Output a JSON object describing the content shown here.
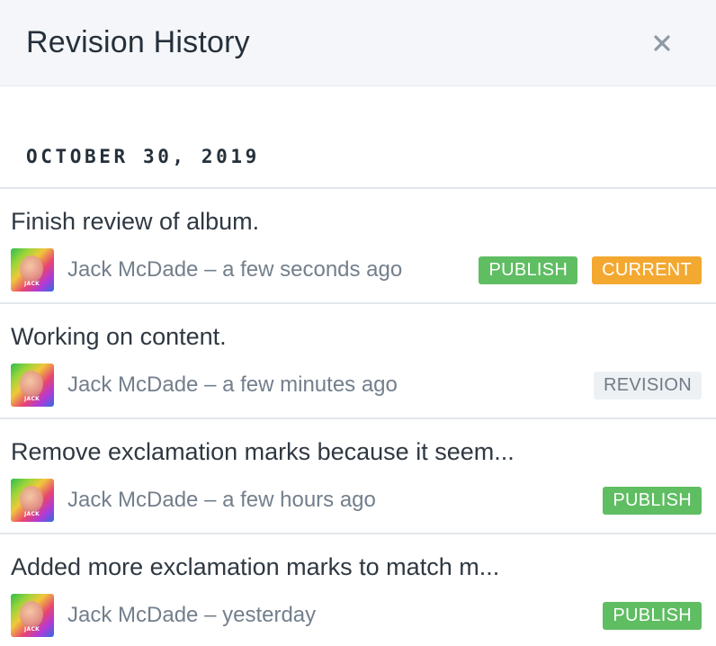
{
  "header": {
    "title": "Revision History",
    "close_icon": "close-icon"
  },
  "date_group": {
    "label": "OCTOBER 30, 2019"
  },
  "revisions": [
    {
      "message": "Finish review of album.",
      "author": "Jack McDade",
      "separator": "–",
      "time": "a few seconds ago",
      "avatar_label": "JACK",
      "badges": [
        {
          "label": "PUBLISH",
          "kind": "publish",
          "color": "#5fbd62"
        },
        {
          "label": "CURRENT",
          "kind": "current",
          "color": "#f3a830"
        }
      ]
    },
    {
      "message": "Working on content.",
      "author": "Jack McDade",
      "separator": "–",
      "time": "a few minutes ago",
      "avatar_label": "JACK",
      "badges": [
        {
          "label": "REVISION",
          "kind": "revision-badge",
          "color": "#eef1f4"
        }
      ]
    },
    {
      "message": "Remove exclamation marks because it seem...",
      "author": "Jack McDade",
      "separator": "–",
      "time": "a few hours ago",
      "avatar_label": "JACK",
      "badges": [
        {
          "label": "PUBLISH",
          "kind": "publish",
          "color": "#5fbd62"
        }
      ]
    },
    {
      "message": "Added more exclamation marks to match m...",
      "author": "Jack McDade",
      "separator": "–",
      "time": "yesterday",
      "avatar_label": "JACK",
      "badges": [
        {
          "label": "PUBLISH",
          "kind": "publish",
          "color": "#5fbd62"
        }
      ]
    }
  ]
}
